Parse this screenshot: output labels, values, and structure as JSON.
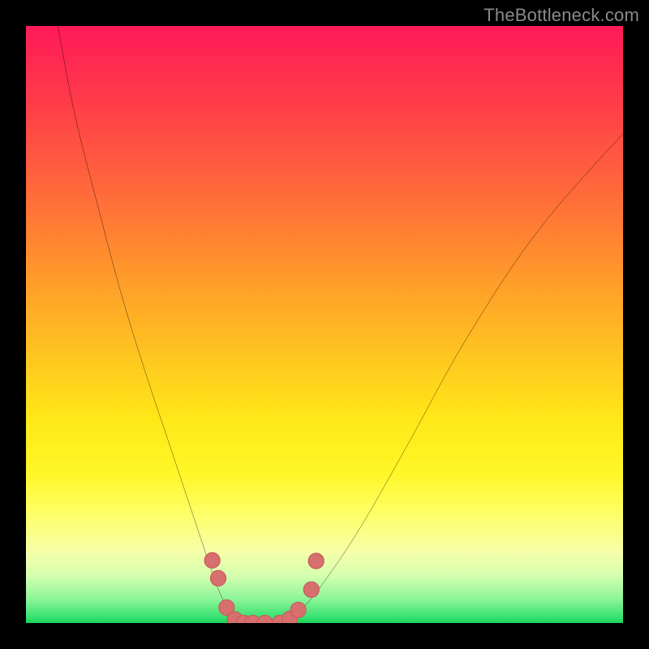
{
  "watermark": "TheBottleneck.com",
  "colors": {
    "frame": "#000000",
    "curve_stroke": "#000000",
    "marker_fill": "#d86f6f",
    "marker_stroke": "#c85a5a"
  },
  "chart_data": {
    "type": "line",
    "title": "",
    "xlabel": "",
    "ylabel": "",
    "xlim": [
      0,
      100
    ],
    "ylim": [
      0,
      100
    ],
    "grid": false,
    "series": [
      {
        "name": "left-descent",
        "x": [
          5,
          8,
          12,
          16,
          20,
          24,
          27,
          29,
          31,
          32.5,
          34,
          35.2,
          36
        ],
        "y": [
          102,
          86,
          70,
          55,
          42,
          30,
          21,
          15,
          9,
          5,
          2,
          0.5,
          0
        ]
      },
      {
        "name": "valley-floor",
        "x": [
          36,
          38,
          40,
          42,
          44
        ],
        "y": [
          0,
          0,
          0,
          0,
          0
        ]
      },
      {
        "name": "right-ascent",
        "x": [
          44,
          46,
          50,
          56,
          64,
          74,
          86,
          100
        ],
        "y": [
          0,
          2,
          7,
          16,
          30,
          48,
          66,
          82
        ]
      }
    ],
    "markers": [
      {
        "x": 31.2,
        "y": 10.5,
        "r": 1.3
      },
      {
        "x": 32.2,
        "y": 7.5,
        "r": 1.3
      },
      {
        "x": 33.6,
        "y": 2.6,
        "r": 1.3
      },
      {
        "x": 35.0,
        "y": 0.6,
        "r": 1.3
      },
      {
        "x": 36.5,
        "y": 0.0,
        "r": 1.3
      },
      {
        "x": 38.0,
        "y": 0.0,
        "r": 1.3
      },
      {
        "x": 40.0,
        "y": 0.0,
        "r": 1.3
      },
      {
        "x": 42.5,
        "y": 0.0,
        "r": 1.3
      },
      {
        "x": 44.2,
        "y": 0.7,
        "r": 1.3
      },
      {
        "x": 45.6,
        "y": 2.2,
        "r": 1.3
      },
      {
        "x": 47.8,
        "y": 5.6,
        "r": 1.3
      },
      {
        "x": 48.6,
        "y": 10.4,
        "r": 1.3
      }
    ]
  }
}
